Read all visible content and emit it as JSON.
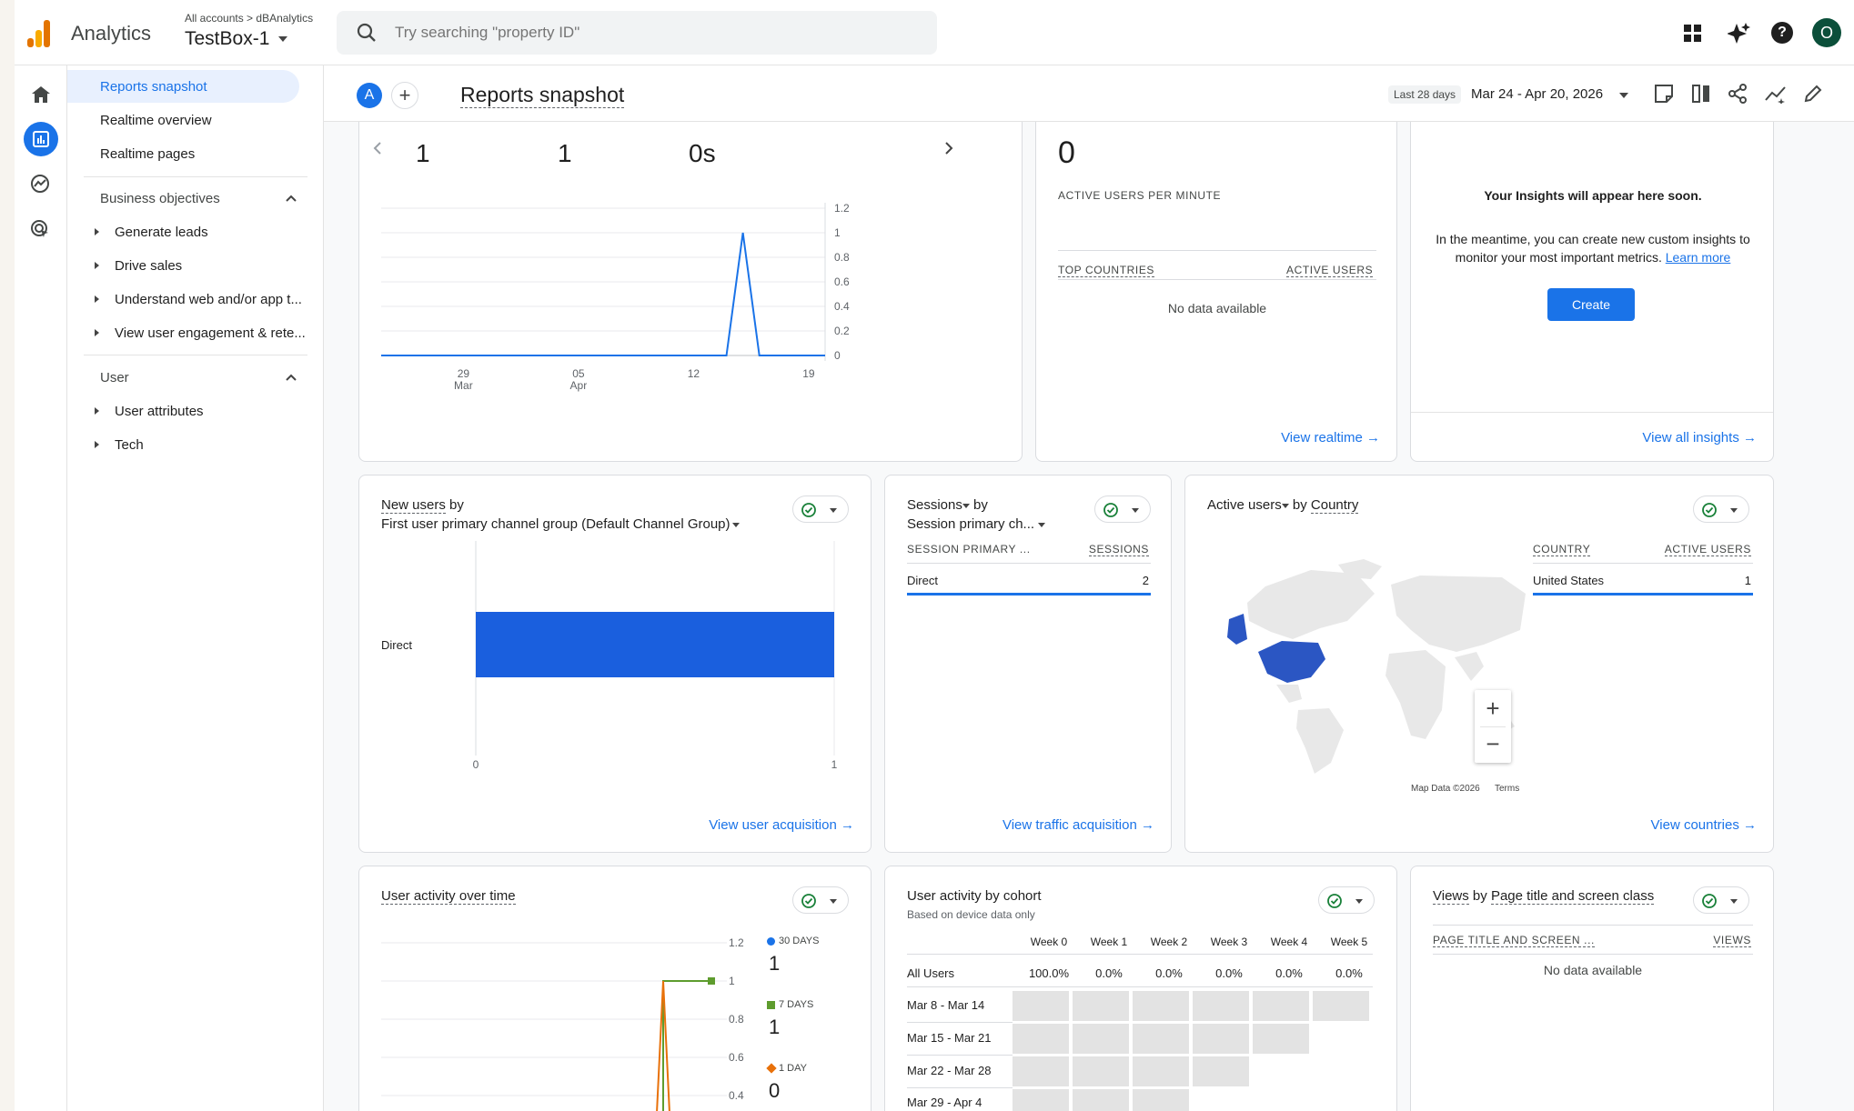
{
  "app": {
    "name": "Analytics",
    "breadcrumb_accounts": "All accounts",
    "breadcrumb_separator": ">",
    "breadcrumb_account": "dBAnalytics",
    "property": "TestBox-1"
  },
  "search": {
    "placeholder": "Try searching \"property ID\""
  },
  "user": {
    "avatar_letter": "O"
  },
  "nav": {
    "items": [
      "Reports snapshot",
      "Realtime overview",
      "Realtime pages"
    ],
    "sections": [
      {
        "label": "Business objectives",
        "items": [
          "Generate leads",
          "Drive sales",
          "Understand web and/or app t...",
          "View user engagement & rete..."
        ]
      },
      {
        "label": "User",
        "items": [
          "User attributes",
          "Tech"
        ]
      }
    ]
  },
  "page": {
    "title": "Reports snapshot",
    "comparison_letter": "A",
    "date_badge": "Last 28 days",
    "date_range": "Mar 24 - Apr 20, 2026"
  },
  "overview": {
    "metrics": [
      "1",
      "1",
      "0s"
    ],
    "y_ticks": [
      "1.2",
      "1",
      "0.8",
      "0.6",
      "0.4",
      "0.2",
      "0"
    ],
    "x_ticks": [
      {
        "day": "29",
        "month": "Mar"
      },
      {
        "day": "05",
        "month": "Apr"
      },
      {
        "day": "12",
        "month": ""
      },
      {
        "day": "19",
        "month": ""
      }
    ]
  },
  "realtime": {
    "value": "0",
    "label": "ACTIVE USERS PER MINUTE",
    "col1": "TOP COUNTRIES",
    "col2": "ACTIVE USERS",
    "empty": "No data available",
    "link": "View realtime"
  },
  "insights": {
    "heading": "Your Insights will appear here soon.",
    "body": "In the meantime, you can create new custom insights to monitor your most important metrics.",
    "learn_more": "Learn more",
    "create": "Create",
    "link": "View all insights"
  },
  "new_users": {
    "title_a": "New users",
    "title_b": " by",
    "subtitle": "First user primary channel group (Default Channel Group)",
    "category": "Direct",
    "x_min": "0",
    "x_max": "1",
    "link": "View user acquisition"
  },
  "sessions": {
    "title_a": "Sessions",
    "title_b": " by",
    "subtitle": "Session primary ch...",
    "col1": "SESSION PRIMARY ...",
    "col2": "SESSIONS",
    "row_label": "Direct",
    "row_value": "2",
    "link": "View traffic acquisition"
  },
  "countries": {
    "title_a": "Active users",
    "title_b": " by ",
    "title_c": "Country",
    "col1": "COUNTRY",
    "col2": "ACTIVE USERS",
    "row_label": "United States",
    "row_value": "1",
    "map_data": "Map Data ©2026",
    "terms": "Terms",
    "zoom_in": "+",
    "zoom_out": "−",
    "link": "View countries"
  },
  "activity": {
    "title": "User activity over time",
    "y_ticks": [
      "1.2",
      "1",
      "0.8",
      "0.6",
      "0.4"
    ],
    "legend": [
      {
        "label": "30 DAYS",
        "value": "1"
      },
      {
        "label": "7 DAYS",
        "value": "1"
      },
      {
        "label": "1 DAY",
        "value": "0"
      }
    ]
  },
  "cohort": {
    "title": "User activity by cohort",
    "subtitle": "Based on device data only",
    "weeks": [
      "Week 0",
      "Week 1",
      "Week 2",
      "Week 3",
      "Week 4",
      "Week 5"
    ],
    "all_users_label": "All Users",
    "all_users": [
      "100.0%",
      "0.0%",
      "0.0%",
      "0.0%",
      "0.0%",
      "0.0%"
    ],
    "rows": [
      "Mar 8 - Mar 14",
      "Mar 15 - Mar 21",
      "Mar 22 - Mar 28",
      "Mar 29 - Apr 4"
    ]
  },
  "views": {
    "title_a": "Views",
    "title_b": " by ",
    "title_c": "Page title and screen class",
    "col1": "PAGE TITLE AND SCREEN ...",
    "col2": "VIEWS",
    "empty": "No data available"
  },
  "chart_data": [
    {
      "type": "line",
      "x": [
        "Mar 24",
        "Mar 25",
        "Mar 26",
        "Mar 27",
        "Mar 28",
        "Mar 29",
        "Mar 30",
        "Mar 31",
        "Apr 1",
        "Apr 2",
        "Apr 3",
        "Apr 4",
        "Apr 5",
        "Apr 6",
        "Apr 7",
        "Apr 8",
        "Apr 9",
        "Apr 10",
        "Apr 11",
        "Apr 12",
        "Apr 13",
        "Apr 14",
        "Apr 15",
        "Apr 16",
        "Apr 17",
        "Apr 18",
        "Apr 19",
        "Apr 20"
      ],
      "series": [
        {
          "values": [
            0,
            0,
            0,
            0,
            0,
            0,
            0,
            0,
            0,
            0,
            0,
            0,
            0,
            0,
            0,
            0,
            0,
            0,
            0,
            0,
            0,
            0,
            1,
            0,
            0,
            0,
            0,
            0
          ]
        }
      ],
      "ylim": [
        0,
        1.2
      ],
      "grid": true
    },
    {
      "type": "bar",
      "orientation": "horizontal",
      "categories": [
        "Direct"
      ],
      "values": [
        1
      ],
      "xlim": [
        0,
        1
      ]
    },
    {
      "type": "line",
      "series": [
        {
          "name": "30 DAYS",
          "color": "#1a73e8",
          "last": 1
        },
        {
          "name": "7 DAYS",
          "color": "#5e9c2e",
          "last": 1
        },
        {
          "name": "1 DAY",
          "color": "#e8710a",
          "last": 0
        }
      ],
      "ylim": [
        0.4,
        1.2
      ]
    }
  ],
  "colors": {
    "primary": "#1a73e8",
    "bar": "#1a5fde",
    "nav_active": "#e8f0fe",
    "map_us": "#2b56c3"
  }
}
